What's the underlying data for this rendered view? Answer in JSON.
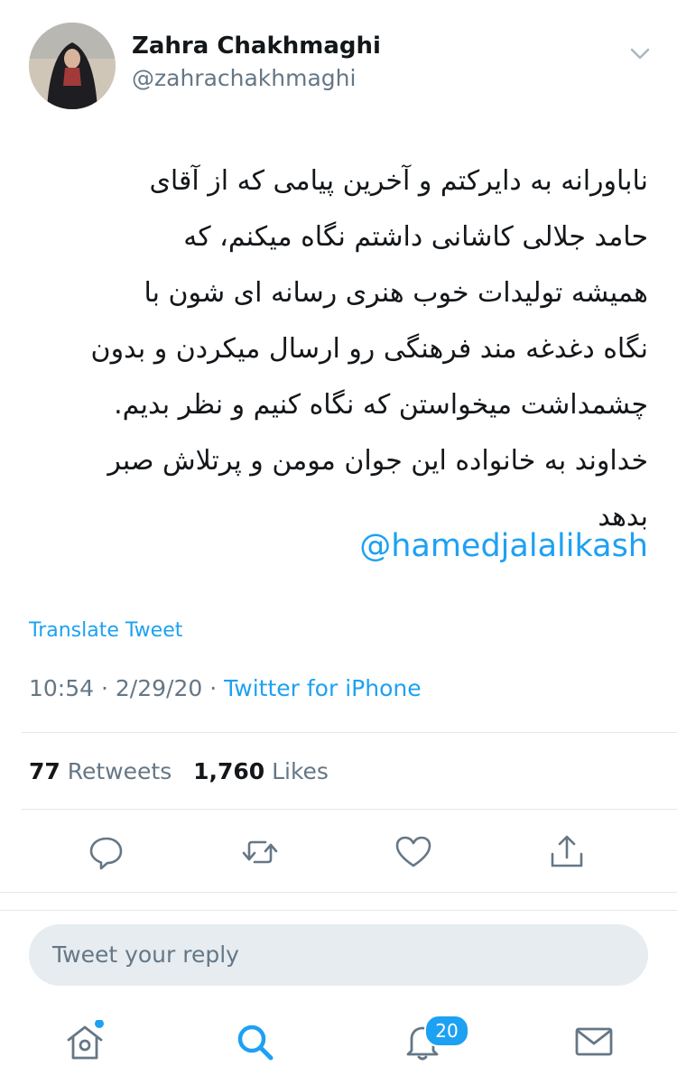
{
  "tweet": {
    "author_name": "Zahra Chakhmaghi",
    "author_handle": "@zahrachakhmaghi",
    "text": "ناباورانه به دایرکتم و آخرین پیامی که از آقای\nحامد جلالی کاشانی داشتم نگاه میکنم، که\nهمیشه تولیدات خوب هنری رسانه ای شون با\nنگاه دغدغه مند فرهنگی رو ارسال میکردن و بدون\nچشمداشت میخواستن که نگاه کنیم و نظر بدیم.\nخداوند به خانواده این جوان مومن و پرتلاش صبر\nبدهد",
    "mention": "@hamedjalalikash",
    "translate_label": "Translate Tweet",
    "time": "10:54",
    "date": "2/29/20",
    "source": "Twitter for iPhone",
    "separator": "·",
    "retweets_count": "77",
    "retweets_label": "Retweets",
    "likes_count": "1,760",
    "likes_label": "Likes"
  },
  "reply": {
    "placeholder": "Tweet your reply"
  },
  "nav": {
    "notifications_badge": "20"
  },
  "colors": {
    "accent": "#1da1f2",
    "muted": "#657786",
    "text": "#14171a",
    "divider": "#e1e8ed"
  },
  "icons": {
    "header": "chevron-down-icon",
    "actions": [
      "reply-icon",
      "retweet-icon",
      "like-icon",
      "share-icon"
    ],
    "nav": [
      "home-icon",
      "search-icon",
      "notifications-icon",
      "messages-icon"
    ]
  }
}
